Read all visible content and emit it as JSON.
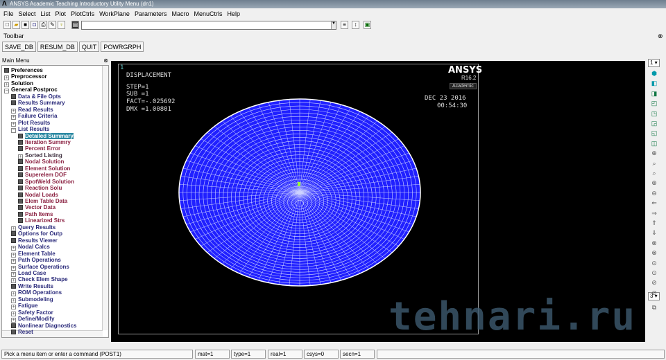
{
  "title": "ANSYS Academic Teaching Introductory Utility Menu (dn1)",
  "menu": [
    "File",
    "Select",
    "List",
    "Plot",
    "PlotCtrls",
    "WorkPlane",
    "Parameters",
    "Macro",
    "MenuCtrls",
    "Help"
  ],
  "command_input": {
    "value": ""
  },
  "toolbar": {
    "label": "Toolbar",
    "buttons": [
      "SAVE_DB",
      "RESUM_DB",
      "QUIT",
      "POWRGRPH"
    ]
  },
  "main_menu": {
    "title": "Main Menu",
    "items": [
      {
        "label": "Preferences",
        "level": 0,
        "icon": "box",
        "color": "#000"
      },
      {
        "label": "Preprocessor",
        "level": 0,
        "icon": "plus",
        "color": "#000"
      },
      {
        "label": "Solution",
        "level": 0,
        "icon": "plus",
        "color": "#000"
      },
      {
        "label": "General Postproc",
        "level": 0,
        "icon": "minus",
        "color": "#000"
      },
      {
        "label": "Data & File Opts",
        "level": 1,
        "icon": "box",
        "color": "#2a2a7a"
      },
      {
        "label": "Results Summary",
        "level": 1,
        "icon": "box",
        "color": "#2a2a7a"
      },
      {
        "label": "Read Results",
        "level": 1,
        "icon": "plus",
        "color": "#2a2a7a"
      },
      {
        "label": "Failure Criteria",
        "level": 1,
        "icon": "plus",
        "color": "#2a2a7a"
      },
      {
        "label": "Plot Results",
        "level": 1,
        "icon": "plus",
        "color": "#2a2a7a"
      },
      {
        "label": "List Results",
        "level": 1,
        "icon": "minus",
        "color": "#2a2a7a"
      },
      {
        "label": "Detailed Summary",
        "level": 2,
        "icon": "box",
        "color": "#fff",
        "selected": true
      },
      {
        "label": "Iteration Summry",
        "level": 2,
        "icon": "box",
        "color": "#8a2040"
      },
      {
        "label": "Percent Error",
        "level": 2,
        "icon": "box",
        "color": "#8a2040"
      },
      {
        "label": "Sorted Listing",
        "level": 2,
        "icon": "plus",
        "color": "#3a2a3a"
      },
      {
        "label": "Nodal Solution",
        "level": 2,
        "icon": "box",
        "color": "#8a2040"
      },
      {
        "label": "Element Solution",
        "level": 2,
        "icon": "box",
        "color": "#8a2040"
      },
      {
        "label": "Superelem DOF",
        "level": 2,
        "icon": "box",
        "color": "#8a2040"
      },
      {
        "label": "SpotWeld Solution",
        "level": 2,
        "icon": "box",
        "color": "#8a2040"
      },
      {
        "label": "Reaction Solu",
        "level": 2,
        "icon": "box",
        "color": "#8a2040"
      },
      {
        "label": "Nodal Loads",
        "level": 2,
        "icon": "box",
        "color": "#8a2040"
      },
      {
        "label": "Elem Table Data",
        "level": 2,
        "icon": "box",
        "color": "#8a2040"
      },
      {
        "label": "Vector Data",
        "level": 2,
        "icon": "box",
        "color": "#8a2040"
      },
      {
        "label": "Path Items",
        "level": 2,
        "icon": "box",
        "color": "#8a2040"
      },
      {
        "label": "Linearized Strs",
        "level": 2,
        "icon": "box",
        "color": "#8a2040"
      },
      {
        "label": "Query Results",
        "level": 1,
        "icon": "plus",
        "color": "#2a2a7a"
      },
      {
        "label": "Options for Outp",
        "level": 1,
        "icon": "box",
        "color": "#2a2a7a"
      },
      {
        "label": "Results Viewer",
        "level": 1,
        "icon": "box",
        "color": "#2a2a7a"
      },
      {
        "label": "Nodal Calcs",
        "level": 1,
        "icon": "plus",
        "color": "#2a2a7a"
      },
      {
        "label": "Element Table",
        "level": 1,
        "icon": "plus",
        "color": "#2a2a7a"
      },
      {
        "label": "Path Operations",
        "level": 1,
        "icon": "plus",
        "color": "#2a2a7a"
      },
      {
        "label": "Surface Operations",
        "level": 1,
        "icon": "plus",
        "color": "#2a2a7a"
      },
      {
        "label": "Load Case",
        "level": 1,
        "icon": "plus",
        "color": "#2a2a7a"
      },
      {
        "label": "Check Elem Shape",
        "level": 1,
        "icon": "plus",
        "color": "#2a2a7a"
      },
      {
        "label": "Write Results",
        "level": 1,
        "icon": "box",
        "color": "#2a2a7a"
      },
      {
        "label": "ROM Operations",
        "level": 1,
        "icon": "plus",
        "color": "#2a2a7a"
      },
      {
        "label": "Submodeling",
        "level": 1,
        "icon": "plus",
        "color": "#2a2a7a"
      },
      {
        "label": "Fatigue",
        "level": 1,
        "icon": "plus",
        "color": "#2a2a7a"
      },
      {
        "label": "Safety Factor",
        "level": 1,
        "icon": "plus",
        "color": "#2a2a7a"
      },
      {
        "label": "Define/Modify",
        "level": 1,
        "icon": "plus",
        "color": "#2a2a7a"
      },
      {
        "label": "Nonlinear Diagnostics",
        "level": 1,
        "icon": "box",
        "color": "#2a2a7a"
      },
      {
        "label": "Reset",
        "level": 1,
        "icon": "box",
        "color": "#2a2a7a"
      }
    ]
  },
  "graphics": {
    "window_number": "1",
    "title": "DISPLACEMENT",
    "step": "STEP=1",
    "sub": "SUB =1",
    "fact": "FACT=-.025692",
    "dmx": "DMX =1.00801",
    "brand": "ANSYS",
    "version": "R16.2",
    "edition": "Academic",
    "date": "DEC 23 2016",
    "time": "00:54:30",
    "mesh_color": "#2020ff"
  },
  "right_toolbar": {
    "window_select": "1",
    "zoom_select": "3"
  },
  "watermark": "tehnari.ru",
  "status": {
    "prompt": "Pick a menu item or enter a command (POST1)",
    "mat": "mat=1",
    "type": "type=1",
    "real": "real=1",
    "csys": "csys=0",
    "secn": "secn=1"
  }
}
